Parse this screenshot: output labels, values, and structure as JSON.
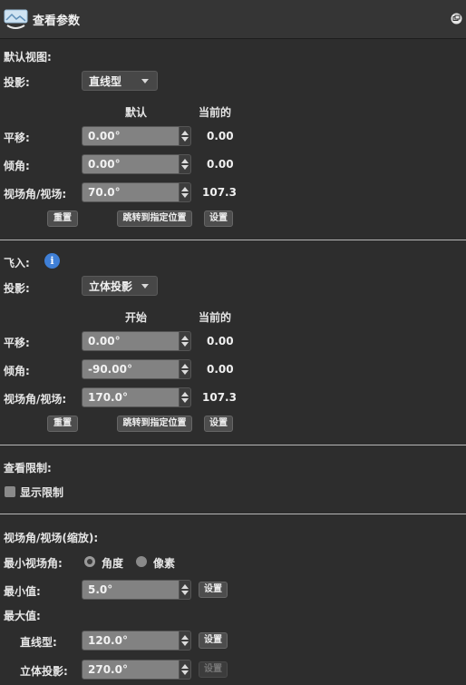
{
  "panel": {
    "title": "查看参数"
  },
  "default_view": {
    "section_title": "默认视图:",
    "projection_label": "投影:",
    "projection_value": "直线型",
    "col_default": "默认",
    "col_current": "当前的",
    "rows": [
      {
        "label": "平移:",
        "value": "0.00°",
        "current": "0.00"
      },
      {
        "label": "倾角:",
        "value": "0.00°",
        "current": "0.00"
      },
      {
        "label": "视场角/视场:",
        "value": "70.0°",
        "current": "107.3"
      }
    ],
    "btn_reset": "重置",
    "btn_jump": "跳转到指定位置",
    "btn_set": "设置"
  },
  "fly_in": {
    "section_title": "飞入:",
    "info_icon": "i",
    "projection_label": "投影:",
    "projection_value": "立体投影",
    "col_start": "开始",
    "col_current": "当前的",
    "rows": [
      {
        "label": "平移:",
        "value": "0.00°",
        "current": "0.00"
      },
      {
        "label": "倾角:",
        "value": "-90.00°",
        "current": "0.00"
      },
      {
        "label": "视场角/视场:",
        "value": "170.0°",
        "current": "107.3"
      }
    ],
    "btn_reset": "重置",
    "btn_jump": "跳转到指定位置",
    "btn_set": "设置"
  },
  "view_limits": {
    "section_title": "查看限制:",
    "show_limits_label": "显示限制",
    "show_limits_checked": false
  },
  "fov_zoom": {
    "section_title": "视场角/视场(缩放):",
    "min_fov_label": "最小视场角:",
    "radio_degrees": "角度",
    "radio_pixels": "像素",
    "selected_unit": "角度",
    "min_value_label": "最小值:",
    "min_value": "5.0°",
    "max_value_label": "最大值:",
    "rectilinear_label": "直线型:",
    "rectilinear_value": "120.0°",
    "stereographic_label": "立体投影:",
    "stereographic_value": "270.0°",
    "btn_set": "设置"
  }
}
